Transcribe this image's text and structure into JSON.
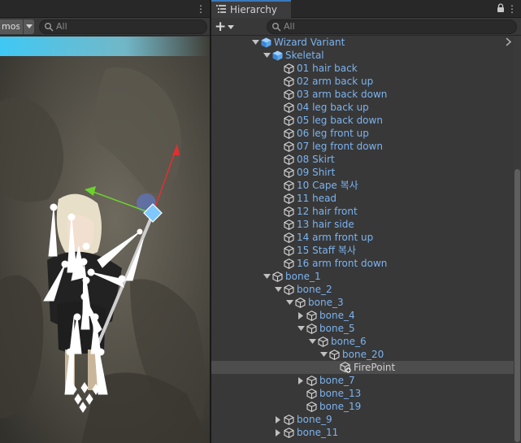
{
  "scene": {
    "gizmos_label": "mos",
    "search_placeholder": "All",
    "menu_glyph": "⋮",
    "icons": {
      "search": "search-icon",
      "dropdown": "triangle-down-icon"
    }
  },
  "hierarchy": {
    "tab_title": "Hierarchy",
    "search_placeholder": "All",
    "menu_glyph": "⋮",
    "add_glyph": "+",
    "icons": {
      "tab": "hierarchy-list-icon",
      "lock": "lock-icon",
      "search": "search-icon",
      "more": "chevron-right-icon"
    },
    "items": [
      {
        "label": "Wizard Variant",
        "depth": 0,
        "arrow": "expanded",
        "icon": "prefab-icon",
        "color": "blue"
      },
      {
        "label": "Skeletal",
        "depth": 1,
        "arrow": "expanded",
        "icon": "prefab-icon",
        "color": "blue"
      },
      {
        "label": "01 hair back",
        "depth": 2,
        "arrow": "none",
        "icon": "gameobject-icon",
        "color": "blue"
      },
      {
        "label": "02 arm back up",
        "depth": 2,
        "arrow": "none",
        "icon": "gameobject-icon",
        "color": "blue"
      },
      {
        "label": "03 arm back down",
        "depth": 2,
        "arrow": "none",
        "icon": "gameobject-icon",
        "color": "blue"
      },
      {
        "label": "04 leg back up",
        "depth": 2,
        "arrow": "none",
        "icon": "gameobject-icon",
        "color": "blue"
      },
      {
        "label": "05 leg back down",
        "depth": 2,
        "arrow": "none",
        "icon": "gameobject-icon",
        "color": "blue"
      },
      {
        "label": "06 leg front up",
        "depth": 2,
        "arrow": "none",
        "icon": "gameobject-icon",
        "color": "blue"
      },
      {
        "label": "07 leg front down",
        "depth": 2,
        "arrow": "none",
        "icon": "gameobject-icon",
        "color": "blue"
      },
      {
        "label": "08 Skirt",
        "depth": 2,
        "arrow": "none",
        "icon": "gameobject-icon",
        "color": "blue"
      },
      {
        "label": "09 Shirt",
        "depth": 2,
        "arrow": "none",
        "icon": "gameobject-icon",
        "color": "blue"
      },
      {
        "label": "10 Cape 복사",
        "depth": 2,
        "arrow": "none",
        "icon": "gameobject-icon",
        "color": "blue"
      },
      {
        "label": "11 head",
        "depth": 2,
        "arrow": "none",
        "icon": "gameobject-icon",
        "color": "blue"
      },
      {
        "label": "12 hair front",
        "depth": 2,
        "arrow": "none",
        "icon": "gameobject-icon",
        "color": "blue"
      },
      {
        "label": "13 hair side",
        "depth": 2,
        "arrow": "none",
        "icon": "gameobject-icon",
        "color": "blue"
      },
      {
        "label": "14 arm front up",
        "depth": 2,
        "arrow": "none",
        "icon": "gameobject-icon",
        "color": "blue"
      },
      {
        "label": "15 Staff 복사",
        "depth": 2,
        "arrow": "none",
        "icon": "gameobject-icon",
        "color": "blue"
      },
      {
        "label": "16 arm front down",
        "depth": 2,
        "arrow": "none",
        "icon": "gameobject-icon",
        "color": "blue"
      },
      {
        "label": "bone_1",
        "depth": 1,
        "arrow": "expanded",
        "icon": "gameobject-icon",
        "color": "blue"
      },
      {
        "label": "bone_2",
        "depth": 2,
        "arrow": "expanded",
        "icon": "gameobject-icon",
        "color": "blue"
      },
      {
        "label": "bone_3",
        "depth": 3,
        "arrow": "expanded",
        "icon": "gameobject-icon",
        "color": "blue"
      },
      {
        "label": "bone_4",
        "depth": 4,
        "arrow": "collapsed",
        "icon": "gameobject-icon",
        "color": "blue"
      },
      {
        "label": "bone_5",
        "depth": 4,
        "arrow": "expanded",
        "icon": "gameobject-icon",
        "color": "blue"
      },
      {
        "label": "bone_6",
        "depth": 5,
        "arrow": "expanded",
        "icon": "gameobject-icon",
        "color": "blue"
      },
      {
        "label": "bone_20",
        "depth": 6,
        "arrow": "expanded",
        "icon": "gameobject-icon",
        "color": "blue"
      },
      {
        "label": "FirePoint",
        "depth": 7,
        "arrow": "none",
        "icon": "gameobject-added-icon",
        "color": "white",
        "selected": true
      },
      {
        "label": "bone_7",
        "depth": 4,
        "arrow": "collapsed",
        "icon": "gameobject-icon",
        "color": "blue"
      },
      {
        "label": "bone_13",
        "depth": 4,
        "arrow": "none",
        "icon": "gameobject-icon",
        "color": "blue"
      },
      {
        "label": "bone_19",
        "depth": 4,
        "arrow": "none",
        "icon": "gameobject-icon",
        "color": "blue"
      },
      {
        "label": "bone_9",
        "depth": 2,
        "arrow": "collapsed",
        "icon": "gameobject-icon",
        "color": "blue"
      },
      {
        "label": "bone_11",
        "depth": 2,
        "arrow": "collapsed",
        "icon": "gameobject-icon",
        "color": "blue"
      }
    ]
  },
  "colors": {
    "prefab_text": "#7cb3ef",
    "selection": "#4d4d4d",
    "tab_accent": "#3a79bb",
    "gizmo_x": "#e03030",
    "gizmo_y": "#6cd22e"
  }
}
